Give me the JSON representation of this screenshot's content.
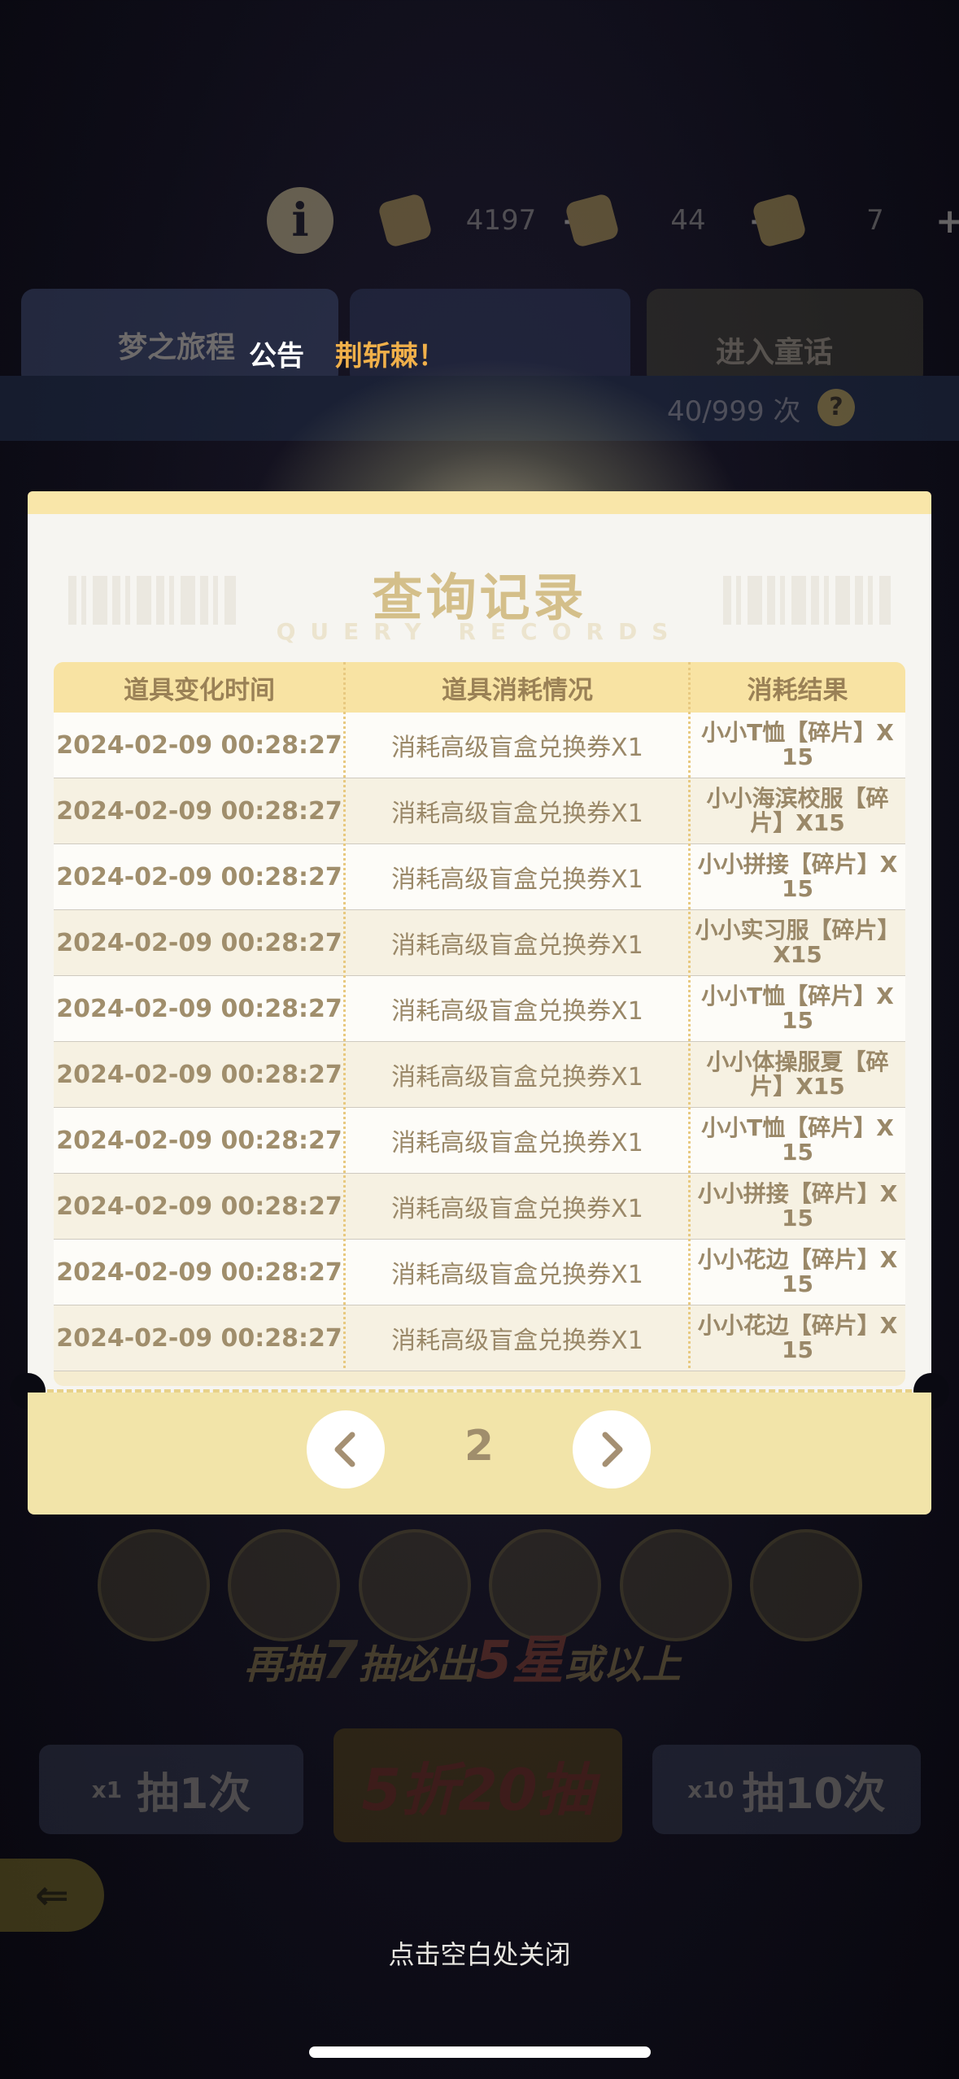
{
  "hud": {
    "info_icon": "i",
    "resources": [
      {
        "icon": "star-currency-icon",
        "value": "4197"
      },
      {
        "icon": "ticket-icon",
        "value": "44"
      },
      {
        "icon": "coupon-icon",
        "value": "7"
      }
    ]
  },
  "background": {
    "tab_label": "梦之旅程",
    "tab_right_label": "进入童话",
    "draw_count": "40/999 次",
    "pity_prefix": "再抽",
    "pity_number": "7",
    "pity_middle": "抽必出",
    "pity_star": "5星",
    "pity_suffix": "或以上",
    "pull_one": "抽1次",
    "pull_one_qty": "x1",
    "pull_discount": "5折20抽",
    "pull_ten": "抽10次",
    "pull_ten_qty": "x10"
  },
  "announcement": {
    "label": "公告",
    "message": "荆斩棘！"
  },
  "modal": {
    "title": "查询记录",
    "subtitle": "QUERY RECORDS",
    "columns": [
      "道具变化时间",
      "道具消耗情况",
      "消耗结果"
    ],
    "rows": [
      [
        "2024-02-09 00:28:27",
        "消耗高级盲盒兑换券X1",
        "小小T恤【碎片】X 15"
      ],
      [
        "2024-02-09 00:28:27",
        "消耗高级盲盒兑换券X1",
        "小小海滨校服【碎片】X15"
      ],
      [
        "2024-02-09 00:28:27",
        "消耗高级盲盒兑换券X1",
        "小小拼接【碎片】X 15"
      ],
      [
        "2024-02-09 00:28:27",
        "消耗高级盲盒兑换券X1",
        "小小实习服【碎片】X15"
      ],
      [
        "2024-02-09 00:28:27",
        "消耗高级盲盒兑换券X1",
        "小小T恤【碎片】X 15"
      ],
      [
        "2024-02-09 00:28:27",
        "消耗高级盲盒兑换券X1",
        "小小体操服夏【碎片】X15"
      ],
      [
        "2024-02-09 00:28:27",
        "消耗高级盲盒兑换券X1",
        "小小T恤【碎片】X 15"
      ],
      [
        "2024-02-09 00:28:27",
        "消耗高级盲盒兑换券X1",
        "小小拼接【碎片】X 15"
      ],
      [
        "2024-02-09 00:28:27",
        "消耗高级盲盒兑换券X1",
        "小小花边【碎片】X 15"
      ],
      [
        "2024-02-09 00:28:27",
        "消耗高级盲盒兑换券X1",
        "小小花边【碎片】X 15"
      ]
    ],
    "page": "2"
  },
  "close_hint": "点击空白处关闭",
  "colors": {
    "accent_gold": "#f9e6a9",
    "announcement_highlight": "#f0b04a",
    "text_brown": "#9a8868"
  }
}
